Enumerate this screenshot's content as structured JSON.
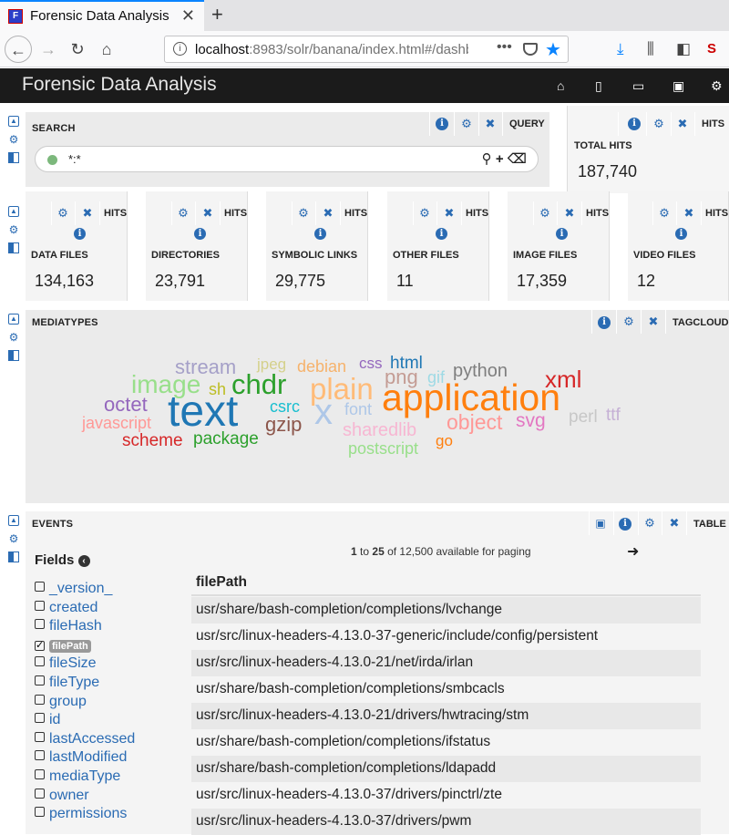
{
  "browser": {
    "tab_title": "Forensic Data Analysis",
    "favicon_text": "F",
    "url_host": "localhost",
    "url_rest": ":8983/solr/banana/index.html#/dashb"
  },
  "app": {
    "title": "Forensic Data Analysis"
  },
  "search_panel": {
    "title": "SEARCH",
    "type_label": "QUERY",
    "query": "*:*"
  },
  "total_hits": {
    "type_label": "HITS",
    "label": "TOTAL HITS",
    "value": "187,740"
  },
  "hit_panels": [
    {
      "type_label": "HITS",
      "label": "DATA FILES",
      "value": "134,163"
    },
    {
      "type_label": "HITS",
      "label": "DIRECTORIES",
      "value": "23,791"
    },
    {
      "type_label": "HITS",
      "label": "SYMBOLIC LINKS",
      "value": "29,775"
    },
    {
      "type_label": "HITS",
      "label": "OTHER FILES",
      "value": "11"
    },
    {
      "type_label": "HITS",
      "label": "IMAGE FILES",
      "value": "17,359"
    },
    {
      "type_label": "HITS",
      "label": "VIDEO FILES",
      "value": "12"
    }
  ],
  "mediatypes": {
    "title": "MEDIATYPES",
    "type_label": "TAGCLOUD",
    "tags": [
      {
        "text": "stream",
        "color": "#a5a0c8"
      },
      {
        "text": "jpeg",
        "color": "#d4d08a"
      },
      {
        "text": "debian",
        "color": "#f6b26b"
      },
      {
        "text": "css",
        "color": "#9467bd"
      },
      {
        "text": "html",
        "color": "#1f77b4"
      },
      {
        "text": "image",
        "color": "#98df8a"
      },
      {
        "text": "sh",
        "color": "#bcbd22"
      },
      {
        "text": "chdr",
        "color": "#2ca02c"
      },
      {
        "text": "plain",
        "color": "#ffbb78"
      },
      {
        "text": "png",
        "color": "#c49c94"
      },
      {
        "text": "gif",
        "color": "#9edae5"
      },
      {
        "text": "python",
        "color": "#7f7f7f"
      },
      {
        "text": "xml",
        "color": "#d62728"
      },
      {
        "text": "application",
        "color": "#ff7f0e"
      },
      {
        "text": "octet",
        "color": "#9467bd"
      },
      {
        "text": "text",
        "color": "#1f77b4"
      },
      {
        "text": "csrc",
        "color": "#17becf"
      },
      {
        "text": "x",
        "color": "#aec7e8"
      },
      {
        "text": "font",
        "color": "#aec7e8"
      },
      {
        "text": "javascript",
        "color": "#ff9896"
      },
      {
        "text": "gzip",
        "color": "#8c564b"
      },
      {
        "text": "sharedlib",
        "color": "#f7b6d2"
      },
      {
        "text": "object",
        "color": "#ff9896"
      },
      {
        "text": "svg",
        "color": "#e377c2"
      },
      {
        "text": "perl",
        "color": "#c7c7c7"
      },
      {
        "text": "ttf",
        "color": "#c5b0d5"
      },
      {
        "text": "scheme",
        "color": "#d62728"
      },
      {
        "text": "package",
        "color": "#2ca02c"
      },
      {
        "text": "postscript",
        "color": "#98df8a"
      },
      {
        "text": "go",
        "color": "#ff7f0e"
      }
    ]
  },
  "events": {
    "title": "EVENTS",
    "type_label": "TABLE",
    "fields_title": "Fields",
    "fields": [
      {
        "name": "_version_",
        "checked": false
      },
      {
        "name": "created",
        "checked": false
      },
      {
        "name": "fileHash",
        "checked": false
      },
      {
        "name": "filePath",
        "checked": true
      },
      {
        "name": "fileSize",
        "checked": false
      },
      {
        "name": "fileType",
        "checked": false
      },
      {
        "name": "group",
        "checked": false
      },
      {
        "name": "id",
        "checked": false
      },
      {
        "name": "lastAccessed",
        "checked": false
      },
      {
        "name": "lastModified",
        "checked": false
      },
      {
        "name": "mediaType",
        "checked": false
      },
      {
        "name": "owner",
        "checked": false
      },
      {
        "name": "permissions",
        "checked": false
      }
    ],
    "paging_start": "1",
    "paging_to": "to",
    "paging_end": "25",
    "paging_rest": "of 12,500 available for paging",
    "column_header": "filePath",
    "rows": [
      "usr/share/bash-completion/completions/lvchange",
      "usr/src/linux-headers-4.13.0-37-generic/include/config/persistent",
      "usr/src/linux-headers-4.13.0-21/net/irda/irlan",
      "usr/share/bash-completion/completions/smbcacls",
      "usr/src/linux-headers-4.13.0-21/drivers/hwtracing/stm",
      "usr/share/bash-completion/completions/ifstatus",
      "usr/share/bash-completion/completions/ldapadd",
      "usr/src/linux-headers-4.13.0-37/drivers/pinctrl/zte",
      "usr/src/linux-headers-4.13.0-37/drivers/pwm"
    ]
  }
}
